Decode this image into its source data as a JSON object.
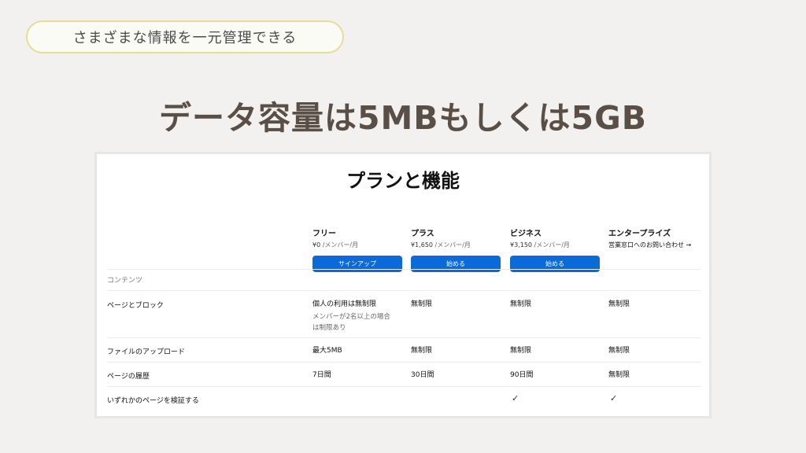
{
  "pill_text": "さまざまな情報を一元管理できる",
  "headline": "データ容量は5MBもしくは5GB",
  "card": {
    "title": "プランと機能",
    "section_label": "コンテンツ",
    "plans": [
      {
        "name": "フリー",
        "price": "¥0",
        "per": " /メンバー/月",
        "cta": "サインアップ"
      },
      {
        "name": "プラス",
        "price": "¥1,650",
        "per": " /メンバー/月",
        "cta": "始める"
      },
      {
        "name": "ビジネス",
        "price": "¥3,150",
        "per": " /メンバー/月",
        "cta": "始める"
      },
      {
        "name": "エンタープライズ",
        "link": "営業窓口へのお問い合わせ →"
      }
    ],
    "rows": [
      {
        "label": "ページとブロック",
        "free": "個人の利用は無制限",
        "free_note": "メンバーが2名以上の場合は制限あり",
        "plus": "無制限",
        "business": "無制限",
        "enterprise": "無制限"
      },
      {
        "label": "ファイルのアップロード",
        "free": "最大5MB",
        "plus": "無制限",
        "business": "無制限",
        "enterprise": "無制限"
      },
      {
        "label": "ページの履歴",
        "free": "7日間",
        "plus": "30日間",
        "business": "90日間",
        "enterprise": "無制限"
      },
      {
        "label": "いずれかのページを検証する",
        "business": "✓",
        "enterprise": "✓"
      }
    ]
  }
}
